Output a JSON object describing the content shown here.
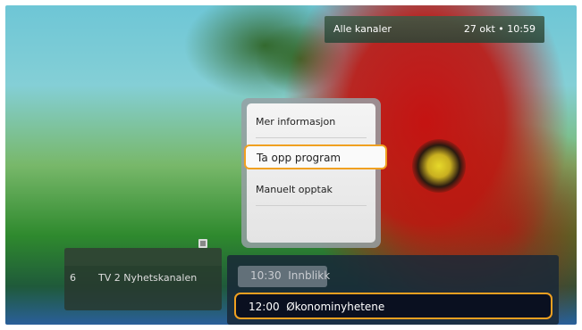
{
  "status_bar": {
    "channel_filter": "Alle kanaler",
    "datetime": "27 okt • 10:59"
  },
  "context_menu": {
    "items": [
      {
        "label": "Mer informasjon",
        "selected": false
      },
      {
        "label": "Ta opp program",
        "selected": true
      },
      {
        "label": "Manuelt opptak",
        "selected": false
      }
    ]
  },
  "channel": {
    "number": "6",
    "name": "TV 2 Nyhetskanalen",
    "icon": "list-icon"
  },
  "programs": [
    {
      "time": "10:30",
      "title": "Innblikk",
      "state": "current"
    },
    {
      "time": "12:00",
      "title": "Økonominyhetene",
      "state": "selected"
    }
  ],
  "colors": {
    "highlight": "#f0a020"
  }
}
